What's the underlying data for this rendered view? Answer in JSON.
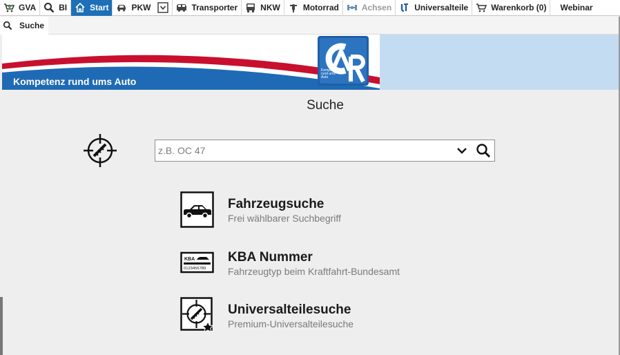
{
  "nav": {
    "items": [
      {
        "label": "GVA",
        "icon": "cart-check-icon"
      },
      {
        "label": "BI",
        "icon": "search-icon"
      },
      {
        "label": "Start",
        "icon": "home-icon"
      },
      {
        "label": "PKW",
        "icon": "car-icon"
      },
      {
        "label": "",
        "icon": "dropdown-box-icon"
      },
      {
        "label": "Transporter",
        "icon": "van-icon"
      },
      {
        "label": "NKW",
        "icon": "truck-icon"
      },
      {
        "label": "Motorrad",
        "icon": "motorcycle-icon"
      },
      {
        "label": "Achsen",
        "icon": "axle-icon"
      },
      {
        "label": "Universalteile",
        "icon": "universal-parts-icon"
      },
      {
        "label": "Warenkorb (0)",
        "icon": "cart-icon"
      },
      {
        "label": "Webinar",
        "icon": ""
      }
    ],
    "active": "Start",
    "disabled": "Achsen"
  },
  "tab": {
    "label": "Suche"
  },
  "banner": {
    "text": "Kompetenz rund ums Auto",
    "logo_text": "Kompetenz rund ums Auto"
  },
  "page": {
    "title": "Suche"
  },
  "search": {
    "placeholder": "z.B. OC 47"
  },
  "options": [
    {
      "title": "Fahrzeugsuche",
      "subtitle": "Frei wählbarer Suchbegriff"
    },
    {
      "title": "KBA Nummer",
      "subtitle": "Fahrzeugtyp beim Kraftfahrt-Bundesamt",
      "icon_text_top": "KBA",
      "icon_text_bottom": "0123456789"
    },
    {
      "title": "Universalteilesuche",
      "subtitle": "Premium-Universalteilesuche"
    }
  ],
  "colors": {
    "active_tab": "#1d6fb8",
    "banner_red": "#c8102e",
    "banner_blue": "#1f6ab5",
    "banner_side": "#c4dcf2"
  }
}
